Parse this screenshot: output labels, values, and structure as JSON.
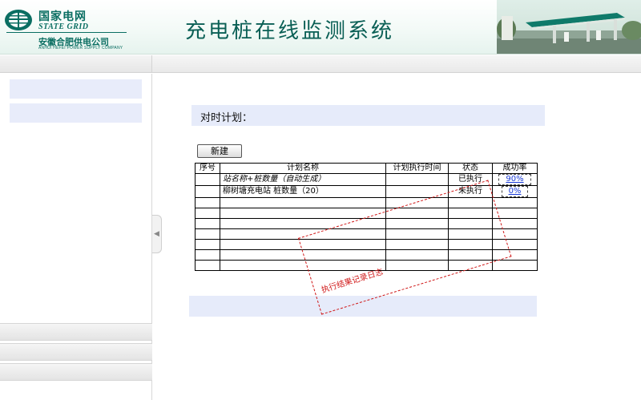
{
  "header": {
    "logo": {
      "cn": "国家电网",
      "en": "STATE GRID",
      "company_cn": "安徽合肥供电公司",
      "company_en": "ANHUI HEFEI POWER SUPPLY COMPANY"
    },
    "system_title": "充电桩在线监测系统"
  },
  "main": {
    "plan_title": "对时计划：",
    "new_button_label": "新建",
    "table": {
      "columns": [
        "序号",
        "计划名称",
        "计划执行时间",
        "状态",
        "成功率"
      ],
      "rows": [
        {
          "index": "",
          "name": "站名称+桩数量（自动生成）",
          "time": "",
          "status": "已执行",
          "rate": "90%"
        },
        {
          "index": "",
          "name": "柳树塘充电站 桩数量（20）",
          "time": "",
          "status": "未执行",
          "rate": "0%"
        }
      ]
    },
    "annotation": "执行结果记录日志"
  },
  "colors": {
    "brand": "#0a6e62",
    "title": "#0a5f55",
    "panel_bg": "#e6ebfa",
    "link": "#1a3bd6",
    "annotation": "#d01818"
  }
}
